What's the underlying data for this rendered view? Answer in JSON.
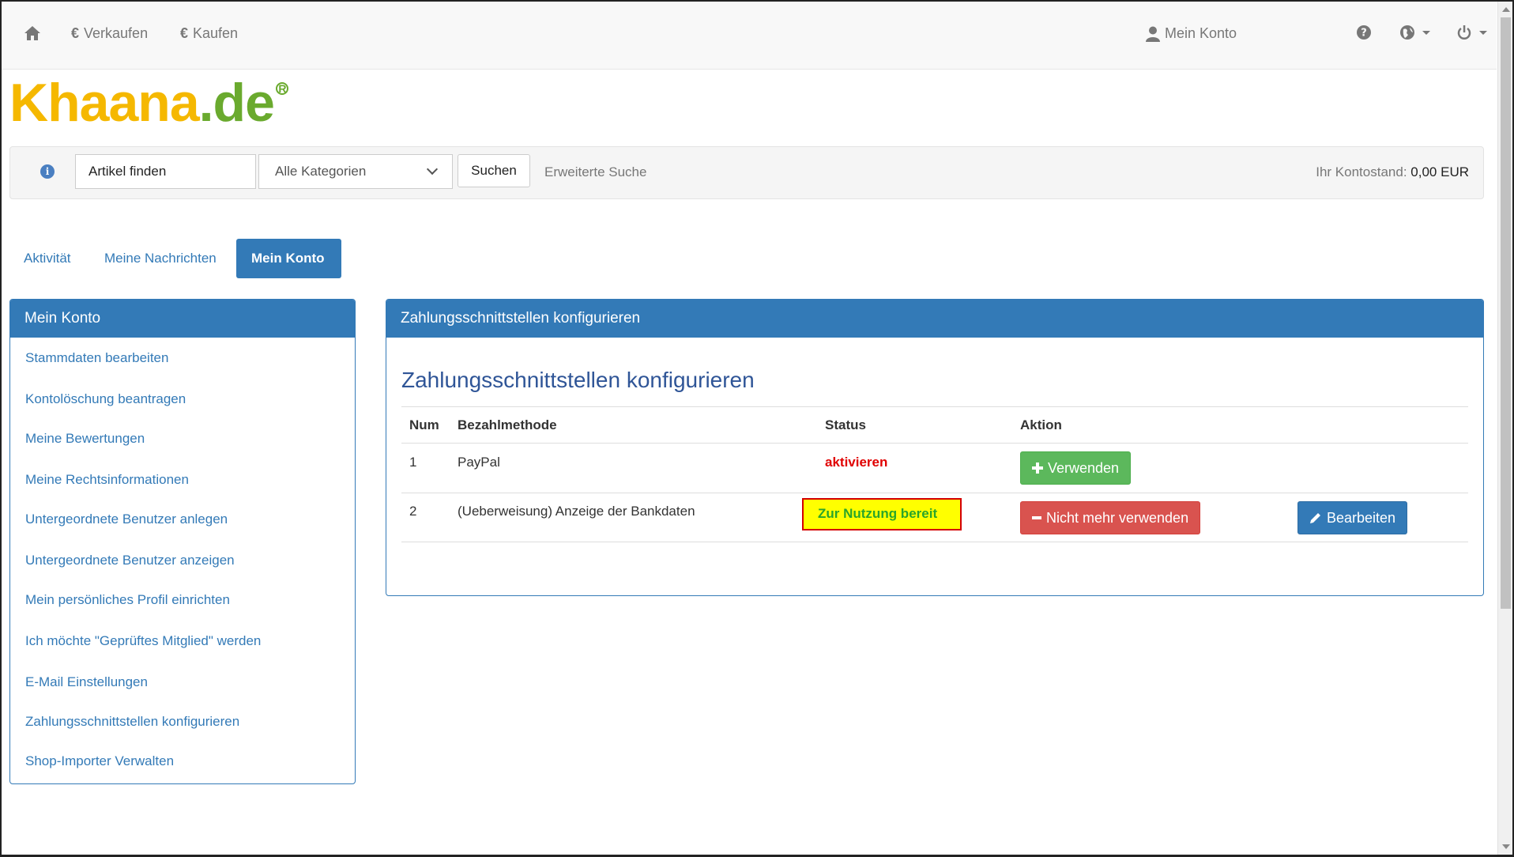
{
  "nav": {
    "verkaufen": "Verkaufen",
    "kaufen": "Kaufen",
    "mein_konto": "Mein Konto"
  },
  "logo": {
    "part1": "Khaana",
    "part2": ".de",
    "reg": "R"
  },
  "search": {
    "value": "Artikel finden",
    "category": "Alle Kategorien",
    "button": "Suchen",
    "advanced": "Erweiterte Suche",
    "balance_label": "Ihr Kontostand:",
    "balance_value": "0,00 EUR"
  },
  "tabs": [
    "Aktivität",
    "Meine Nachrichten",
    "Mein Konto"
  ],
  "sidebar": {
    "title": "Mein Konto",
    "items": [
      "Stammdaten bearbeiten",
      "Kontolöschung beantragen",
      "Meine Bewertungen",
      "Meine Rechtsinformationen",
      "Untergeordnete Benutzer anlegen",
      "Untergeordnete Benutzer anzeigen",
      "Mein persönliches Profil einrichten",
      "Ich möchte \"Geprüftes Mitglied\" werden",
      "E-Mail Einstellungen",
      "Zahlungsschnittstellen konfigurieren",
      "Shop-Importer Verwalten"
    ]
  },
  "main": {
    "heading": "Zahlungsschnittstellen konfigurieren",
    "title": "Zahlungsschnittstellen konfigurieren",
    "columns": [
      "Num",
      "Bezahlmethode",
      "Status",
      "Aktion"
    ],
    "rows": [
      {
        "num": "1",
        "method": "PayPal",
        "status": "aktivieren",
        "action": "Verwenden"
      },
      {
        "num": "2",
        "method": "(Ueberweisung) Anzeige der Bankdaten",
        "status": "Zur Nutzung bereit",
        "action": "Nicht mehr verwenden",
        "action2": "Bearbeiten"
      }
    ]
  },
  "colors": {
    "primary": "#337ab7",
    "success": "#5cb85c",
    "danger": "#d9534f",
    "logo_yellow": "#f5b800",
    "logo_green": "#6aaa2e"
  }
}
